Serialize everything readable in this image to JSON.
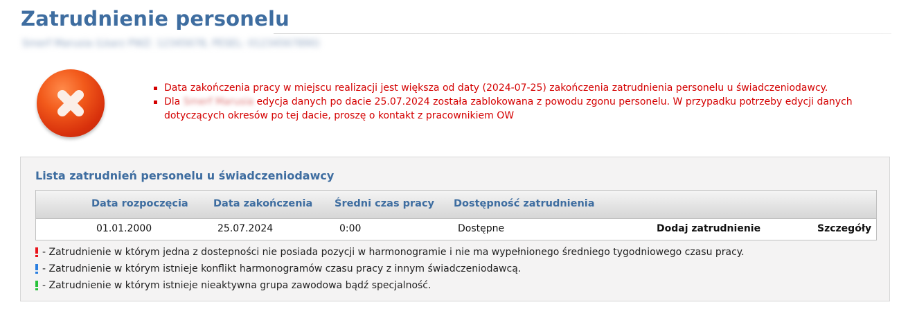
{
  "page": {
    "title": "Zatrudnienie personelu",
    "subtitle": "Smerf Marusia (Lkarz PWZ: 12345678, PESEL: 01234567890)"
  },
  "error": {
    "icon": "error-x-icon",
    "messages": [
      {
        "text": "Data zakończenia pracy w miejscu realizacji jest większa od daty (2024-07-25) zakończenia zatrudnienia personelu u świadczeniodawcy."
      },
      {
        "prefix": "Dla",
        "redacted_name": "Smerf Marusia",
        "text": "edycja danych po dacie 25.07.2024 została zablokowana z powodu zgonu personelu. W przypadku potrzeby edycji danych dotyczących okresów po tej dacie, proszę o kontakt z pracownikiem OW"
      }
    ]
  },
  "list": {
    "title": "Lista zatrudnień personelu u świadczeniodawcy",
    "columns": [
      "Data rozpoczęcia",
      "Data zakończenia",
      "Średni czas pracy",
      "Dostępność zatrudnienia"
    ],
    "rows": [
      {
        "start": "01.01.2000",
        "end": "25.07.2024",
        "avg_time": "0:00",
        "availability": "Dostępne",
        "add_label": "Dodaj zatrudnienie",
        "details_label": "Szczegóły"
      }
    ]
  },
  "legend": [
    {
      "color": "#e8141b",
      "icon": "exclamation-red-icon",
      "text": "- Zatrudnienie w którym jedna z dostepności nie posiada pozycji w harmonogramie i nie ma wypełnionego średniego tygodniowego czasu pracy."
    },
    {
      "color": "#2a7ee0",
      "icon": "exclamation-blue-icon",
      "text": "- Zatrudnienie w którym istnieje konflikt harmonogramów czasu pracy z innym świadczeniodawcą."
    },
    {
      "color": "#27c23a",
      "icon": "exclamation-green-icon",
      "text": "- Zatrudnienie w którym istnieje nieaktywna grupa zawodowa bądź specjalność."
    }
  ],
  "colors": {
    "accent": "#3e6da0",
    "error": "#d40000",
    "panel_bg": "#f4f3f3"
  }
}
